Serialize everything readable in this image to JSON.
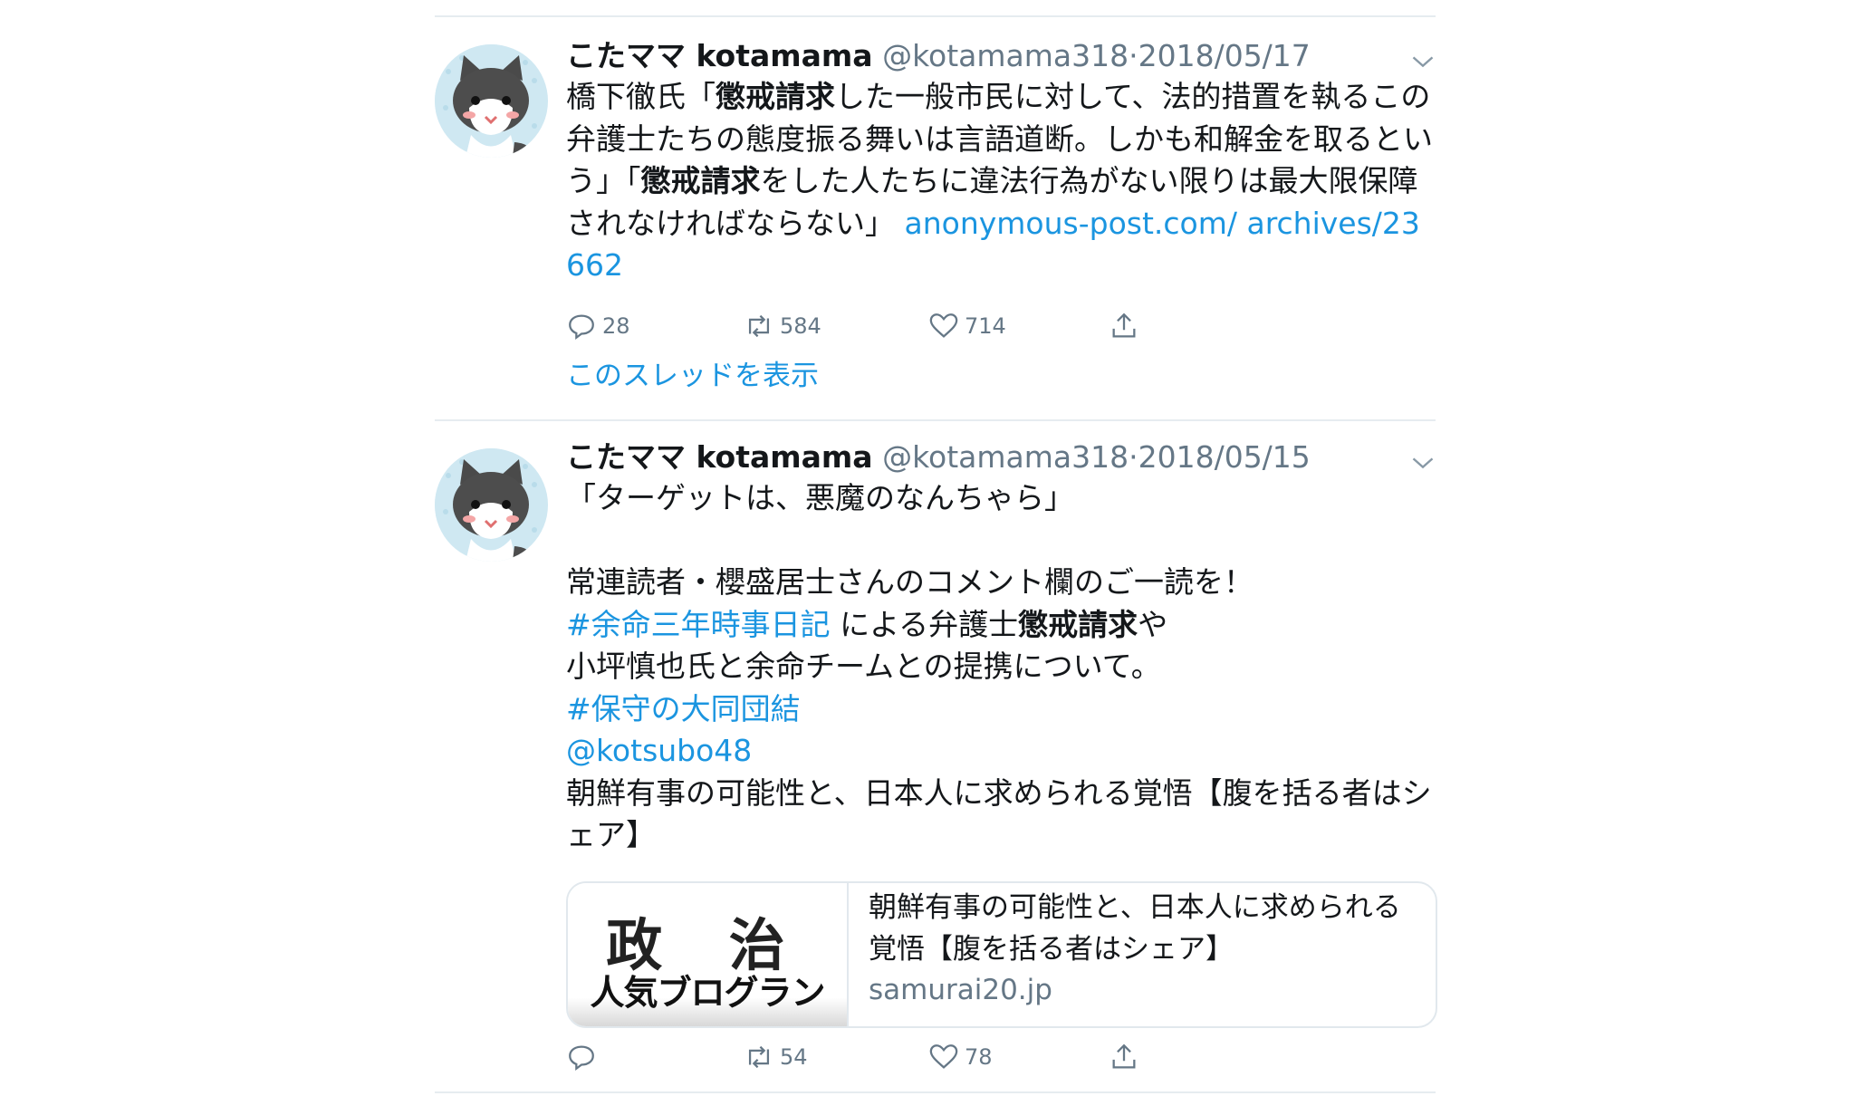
{
  "tweets": [
    {
      "name": "こたママ kotamama",
      "handle": "@kotamama318",
      "dot": "·",
      "date": "2018/05/17",
      "text": {
        "p1": "橋下徹氏「",
        "b1": "懲戒請求",
        "p2": "した一般市民に対して、法的措置を執るこの弁護士たちの態度振る舞いは言語道断。しかも和解金を取るという」「",
        "b2": "懲戒請求",
        "p3": "をした人たちに違法行為がない限りは最大限保障されなければならない」 ",
        "link": "anonymous-post.com/ archives/23662"
      },
      "actions": {
        "reply": "28",
        "retweet": "584",
        "like": "714"
      },
      "thread_label": "このスレッドを表示"
    },
    {
      "name": "こたママ kotamama",
      "handle": "@kotamama318",
      "dot": "·",
      "date": "2018/05/15",
      "lines": {
        "l1": "「ターゲットは、悪魔のなんちゃら」",
        "l2": "常連読者・櫻盛居士さんのコメント欄のご一読を！",
        "hashtag1": "#余命三年時事日記",
        "l3a": " による弁護士",
        "l3b": "懲戒請求",
        "l3c": "や",
        "l4": "小坪慎也氏と余命チームとの提携について。",
        "hashtag2": "#保守の大同団結",
        "mention": "@kotsubo48",
        "l5": "朝鮮有事の可能性と、日本人に求められる覚悟【腹を括る者はシェア】"
      },
      "card": {
        "image_big": "政 治",
        "image_small": "人気ブログラン",
        "title": "朝鮮有事の可能性と、日本人に求められる覚悟【腹を括る者はシェア】",
        "domain": "samurai20.jp"
      },
      "actions": {
        "reply": "",
        "retweet": "54",
        "like": "78"
      }
    }
  ],
  "colors": {
    "link": "#1b95e0",
    "secondary": "#657786",
    "divider": "#e6ecf0"
  }
}
